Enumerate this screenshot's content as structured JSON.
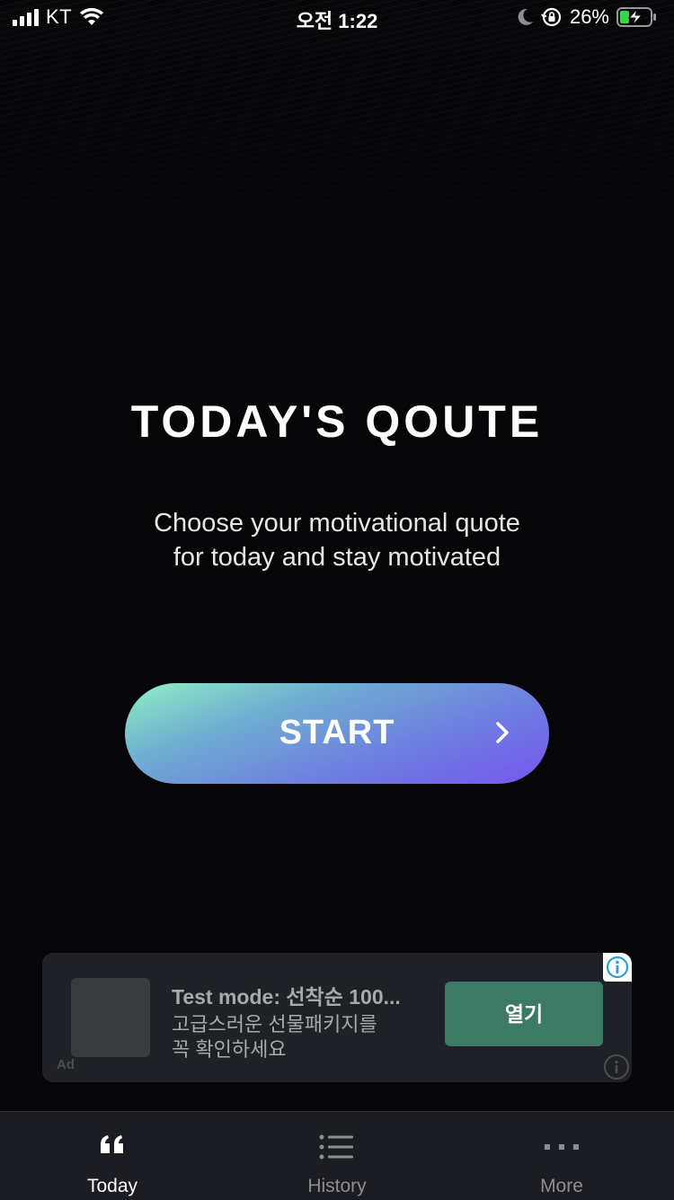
{
  "status_bar": {
    "carrier": "KT",
    "time": "오전 1:22",
    "battery_percent": "26%",
    "icons": [
      "signal-icon",
      "wifi-icon",
      "moon-icon",
      "orientation-lock-icon",
      "battery-charging-icon"
    ]
  },
  "main": {
    "title": "TODAY'S QOUTE",
    "subtitle_line1": "Choose your motivational quote",
    "subtitle_line2": "for today and stay motivated",
    "start_label": "START"
  },
  "colors": {
    "background": "#060608",
    "start_gradient": [
      "#8ff0c4",
      "#6d7fe0",
      "#7556ef"
    ],
    "ad_button": "#3d7a66",
    "tab_bar": "#1c1d22"
  },
  "ad": {
    "tag": "Ad",
    "title": "Test mode: 선착순 100...",
    "desc_line1": "고급스러운 선물패키지를",
    "desc_line2": "꼭 확인하세요",
    "button_label": "열기"
  },
  "tabs": [
    {
      "label": "Today",
      "icon": "quote-icon",
      "active": true
    },
    {
      "label": "History",
      "icon": "list-icon",
      "active": false
    },
    {
      "label": "More",
      "icon": "more-dots-icon",
      "active": false
    }
  ]
}
